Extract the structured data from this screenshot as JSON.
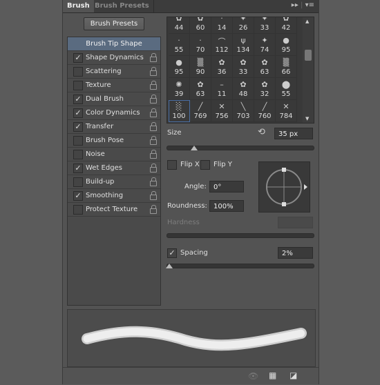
{
  "tabs": {
    "active": "Brush",
    "inactive": "Brush Presets"
  },
  "brush_presets_button": "Brush Presets",
  "options": [
    {
      "label": "Brush Tip Shape",
      "selected": true
    },
    {
      "label": "Shape Dynamics",
      "checked": true
    },
    {
      "label": "Scattering",
      "checked": false
    },
    {
      "label": "Texture",
      "checked": false
    },
    {
      "label": "Dual Brush",
      "checked": true
    },
    {
      "label": "Color Dynamics",
      "checked": true
    },
    {
      "label": "Transfer",
      "checked": true
    },
    {
      "label": "Brush Pose",
      "checked": false
    },
    {
      "label": "Noise",
      "checked": false
    },
    {
      "label": "Wet Edges",
      "checked": true
    },
    {
      "label": "Build-up",
      "checked": false
    },
    {
      "label": "Smoothing",
      "checked": true
    },
    {
      "label": "Protect Texture",
      "checked": false
    }
  ],
  "brush_sizes": [
    "44",
    "60",
    "14",
    "26",
    "33",
    "42",
    "55",
    "70",
    "112",
    "134",
    "74",
    "95",
    "95",
    "90",
    "36",
    "33",
    "63",
    "66",
    "39",
    "63",
    "11",
    "48",
    "32",
    "55",
    "100",
    "769",
    "756",
    "703",
    "760",
    "784"
  ],
  "selected_brush": "100",
  "size": {
    "label": "Size",
    "value": "35 px",
    "slider_percent": 0.17
  },
  "flip_x": {
    "label": "Flip X",
    "checked": false
  },
  "flip_y": {
    "label": "Flip Y",
    "checked": false
  },
  "angle": {
    "label": "Angle:",
    "value": "0°"
  },
  "roundness": {
    "label": "Roundness:",
    "value": "100%"
  },
  "hardness": {
    "label": "Hardness",
    "value": ""
  },
  "spacing": {
    "label": "Spacing",
    "checked": true,
    "value": "2%",
    "slider_percent": 0.01
  },
  "accent": "#5a6b80"
}
